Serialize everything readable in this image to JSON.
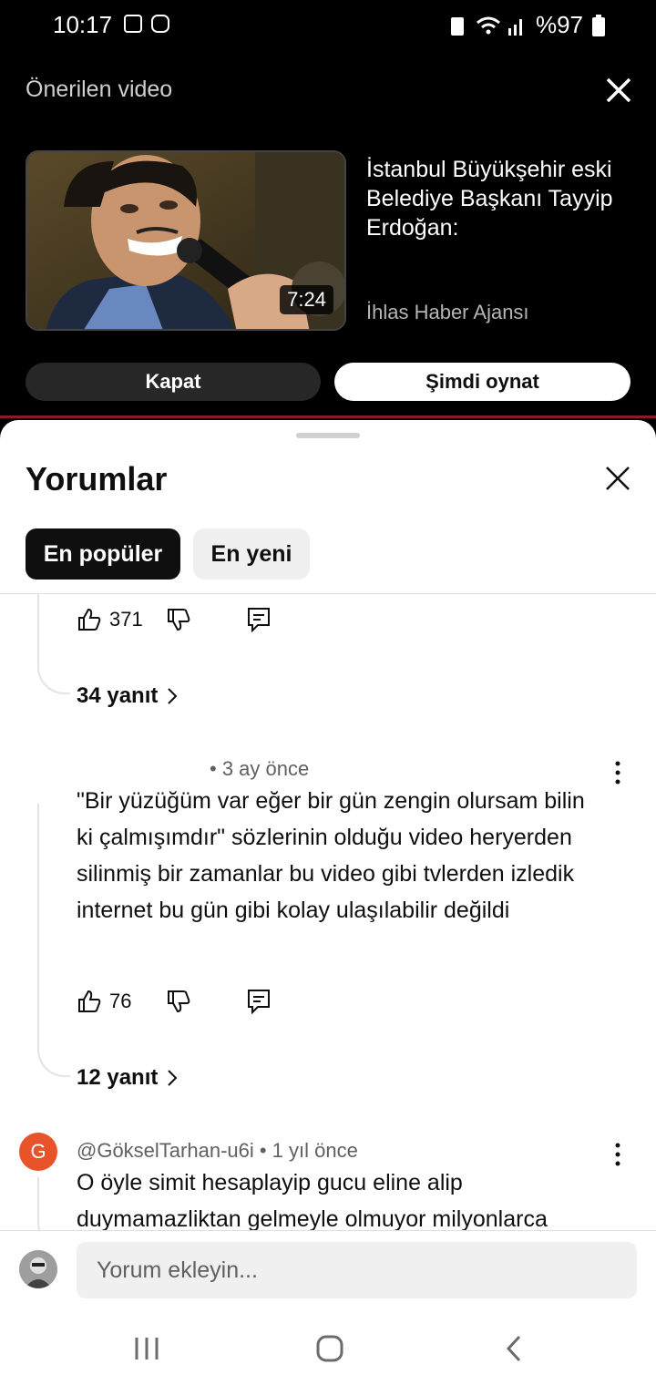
{
  "status_bar": {
    "time": "10:17",
    "battery": "%97"
  },
  "recommended": {
    "header": "Önerilen video",
    "video_title": "İstanbul Büyükşehir eski Belediye Başkanı Tayyip Erdoğan:",
    "channel": "İhlas Haber Ajansı",
    "duration": "7:24",
    "close_button": "Kapat",
    "play_button": "Şimdi oynat"
  },
  "comments_sheet": {
    "title": "Yorumlar",
    "chips": [
      "En popüler",
      "En yeni"
    ],
    "comments": [
      {
        "likes": "371",
        "replies": "34 yanıt"
      },
      {
        "meta": "• 3 ay önce",
        "text": "\"Bir yüzüğüm var eğer bir gün zengin olursam bilin ki çalmışımdır\" sözlerinin olduğu video heryerden silinmiş bir zamanlar bu video gibi tvlerden izledik internet bu gün gibi kolay ulaşılabilir değildi",
        "likes": "76",
        "replies": "12 yanıt"
      },
      {
        "avatar_letter": "G",
        "meta": "@GökselTarhan-u6i • 1 yıl önce",
        "text": "O öyle simit hesaplayip gucu eline alip duymamazliktan gelmeyle olmuyor milyonlarca"
      }
    ],
    "input_placeholder": "Yorum ekleyin..."
  },
  "colors": {
    "accent_line": "#8a1a2e",
    "avatar_g": "#e8532a"
  }
}
